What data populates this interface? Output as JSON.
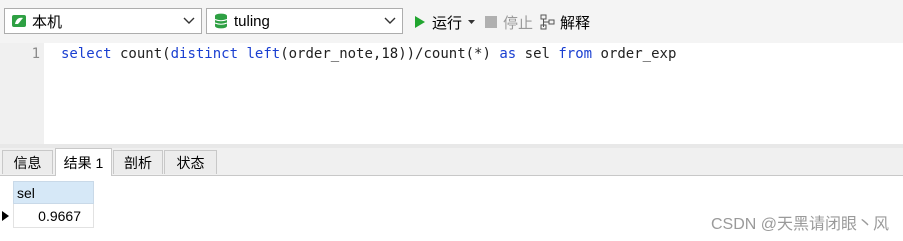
{
  "toolbar": {
    "connection": {
      "value": "本机",
      "icon": "mysql-connection-icon",
      "color": "#2ea043"
    },
    "database": {
      "value": "tuling",
      "icon": "database-icon",
      "color": "#2ea043"
    },
    "run_label": "运行",
    "stop_label": "停止",
    "explain_label": "解释"
  },
  "editor": {
    "line_number": "1",
    "code_parts": {
      "p1": "select",
      "p2": " count(",
      "p3": "distinct",
      "p4": " ",
      "p5": "left",
      "p6": "(order_note,",
      "p7": "18",
      "p8": "))/count(*) ",
      "p9": "as",
      "p10": " sel ",
      "p11": "from",
      "p12": " order_exp"
    }
  },
  "tabs": [
    "信息",
    "结果 1",
    "剖析",
    "状态"
  ],
  "result": {
    "columns": [
      "sel"
    ],
    "rows": [
      [
        "0.9667"
      ]
    ]
  },
  "watermark": "CSDN @天黑请闭眼丶风",
  "colors": {
    "keyword": "#1a3fd1",
    "run_green": "#21a52f",
    "header_blue": "#d6e8f7"
  }
}
